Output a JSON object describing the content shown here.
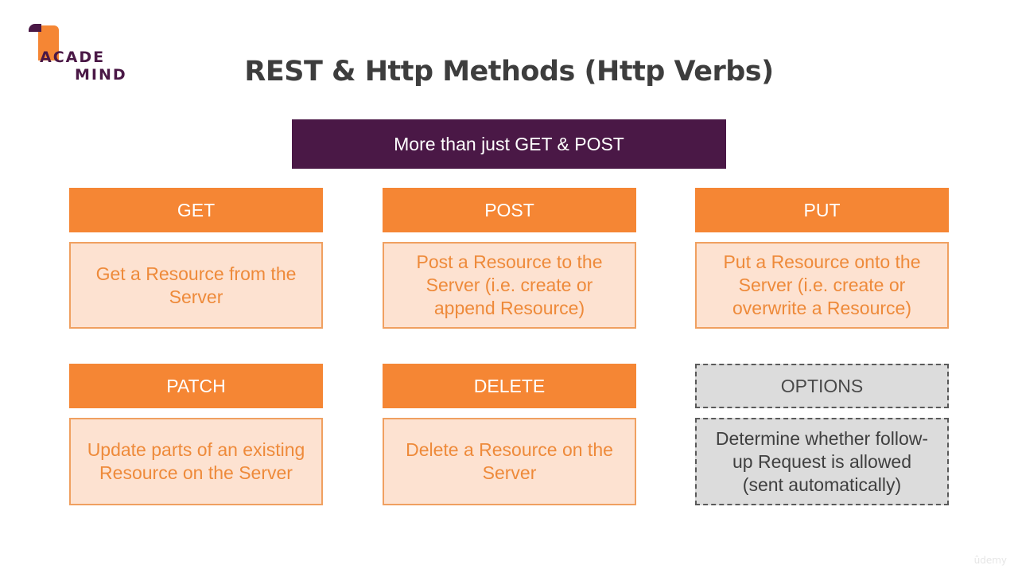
{
  "logo": {
    "line1": "ACADE",
    "line2": "MIND"
  },
  "title": "REST & Http Methods (Http Verbs)",
  "banner": "More than just GET & POST",
  "methods": [
    {
      "name": "GET",
      "description": "Get a Resource from the Server",
      "style": "primary"
    },
    {
      "name": "POST",
      "description": "Post a Resource to the Server (i.e. create or append  Resource)",
      "style": "primary"
    },
    {
      "name": "PUT",
      "description": "Put a Resource onto the Server (i.e. create or overwrite a  Resource)",
      "style": "primary"
    },
    {
      "name": "PATCH",
      "description": "Update parts of an existing Resource on the Server",
      "style": "primary"
    },
    {
      "name": "DELETE",
      "description": "Delete a Resource on the Server",
      "style": "primary"
    },
    {
      "name": "OPTIONS",
      "description": "Determine whether follow-up Request is allowed (sent automatically)",
      "style": "optional"
    }
  ],
  "colors": {
    "brand_purple": "#4a1846",
    "accent_orange": "#f58634",
    "desc_fill": "#fde2d1",
    "optional_fill": "#dcdcdc"
  },
  "watermark": "ûdemy"
}
